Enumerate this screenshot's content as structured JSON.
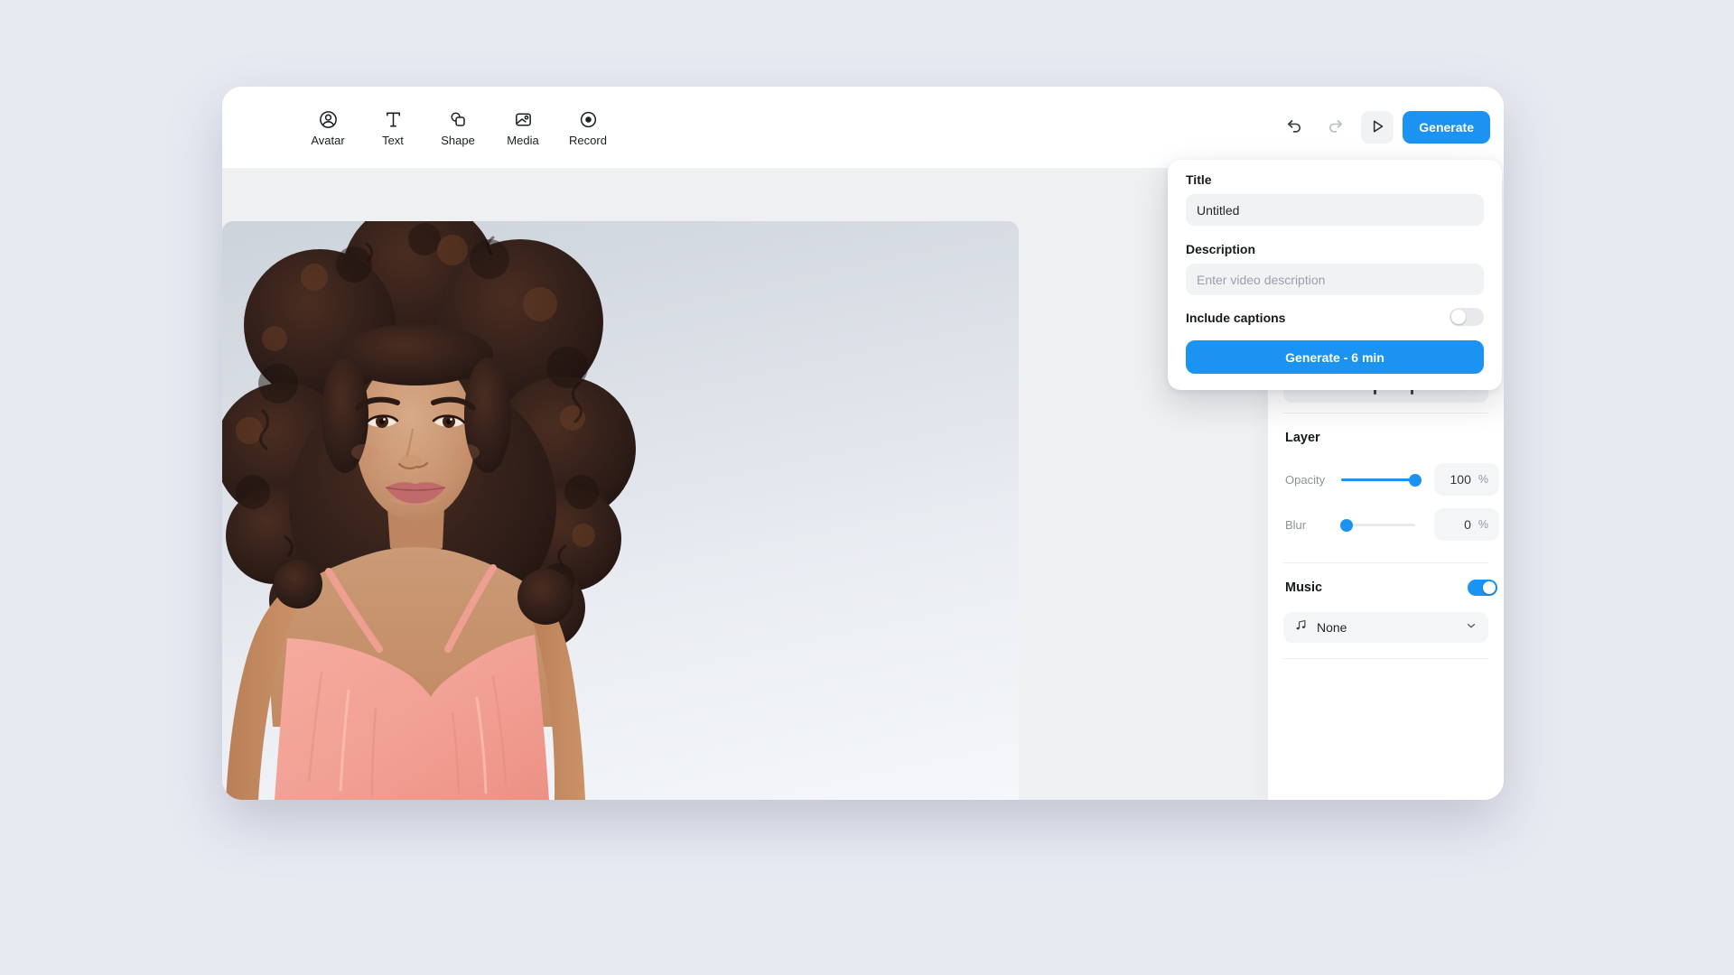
{
  "colors": {
    "accent": "#1b93f2",
    "page_background": "#e8eaf2",
    "workspace_background": "#eef0f2",
    "field_background": "#f2f3f5",
    "canvas_gradient_start": "#cdd3db",
    "canvas_gradient_end": "#f5f7fa"
  },
  "toolbar": {
    "items": [
      {
        "label": "Avatar",
        "icon": "avatar-icon"
      },
      {
        "label": "Text",
        "icon": "text-icon"
      },
      {
        "label": "Shape",
        "icon": "shape-icon"
      },
      {
        "label": "Media",
        "icon": "media-icon"
      },
      {
        "label": "Record",
        "icon": "record-icon"
      }
    ],
    "undo_icon": "undo-icon",
    "redo_icon": "redo-icon",
    "play_icon": "play-icon",
    "generate_label": "Generate"
  },
  "generate_popover": {
    "title_label": "Title",
    "title_value": "Untitled",
    "description_label": "Description",
    "description_placeholder": "Enter video description",
    "captions_label": "Include captions",
    "captions_enabled": false,
    "submit_label": "Generate - 6 min"
  },
  "sidebar": {
    "layer": {
      "heading": "Layer",
      "opacity_label": "Opacity",
      "opacity_value": "100",
      "opacity_unit": "%",
      "opacity_percent": 100,
      "blur_label": "Blur",
      "blur_value": "0",
      "blur_unit": "%",
      "blur_percent": 0
    },
    "music": {
      "heading": "Music",
      "enabled": true,
      "selection": "None",
      "icon": "music-note-icon",
      "chevron": "chevron-down-icon"
    }
  },
  "canvas": {
    "content": "woman avatar with dark curly hair wearing pink camisole on gray studio backdrop"
  }
}
